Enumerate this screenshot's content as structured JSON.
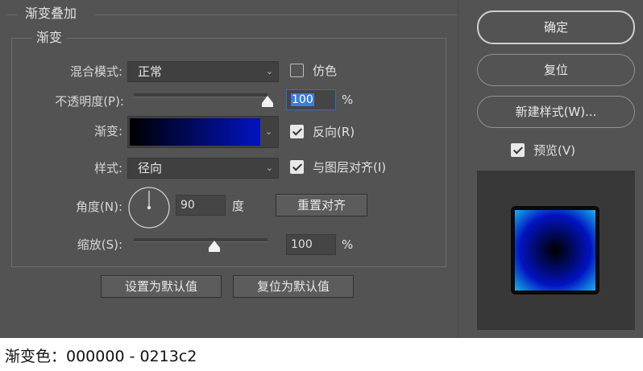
{
  "dialog": {
    "section_title": "渐变叠加",
    "group_title": "渐变",
    "blend_mode": {
      "label": "混合模式:",
      "value": "正常"
    },
    "dither": {
      "label": "仿色",
      "checked": false
    },
    "opacity": {
      "label": "不透明度(P):",
      "value": "100",
      "unit": "%",
      "level": 1.0
    },
    "gradient": {
      "label": "渐变:",
      "color_start": "#000000",
      "color_end": "#0213c2"
    },
    "reverse": {
      "label": "反向(R)",
      "checked": true
    },
    "style": {
      "label": "样式:",
      "value": "径向"
    },
    "align_with_layer": {
      "label": "与图层对齐(I)",
      "checked": true
    },
    "angle": {
      "label": "角度(N):",
      "value": "90",
      "unit": "度",
      "degrees": 90
    },
    "reset_alignment_label": "重置对齐",
    "scale": {
      "label": "缩放(S):",
      "value": "100",
      "unit": "%",
      "level": 0.6
    },
    "set_default_label": "设置为默认值",
    "reset_default_label": "复位为默认值"
  },
  "side": {
    "ok_label": "确定",
    "reset_label": "复位",
    "new_style_label": "新建样式(W)...",
    "preview": {
      "label": "预览(V)",
      "checked": true
    }
  },
  "caption": "渐变色：000000 - 0213c2",
  "colors": {
    "panel": "#535353",
    "field": "#404040",
    "highlight": "#3b7ddd",
    "preview_bg": "#383838",
    "gradient_edge": "#19b3ea"
  }
}
